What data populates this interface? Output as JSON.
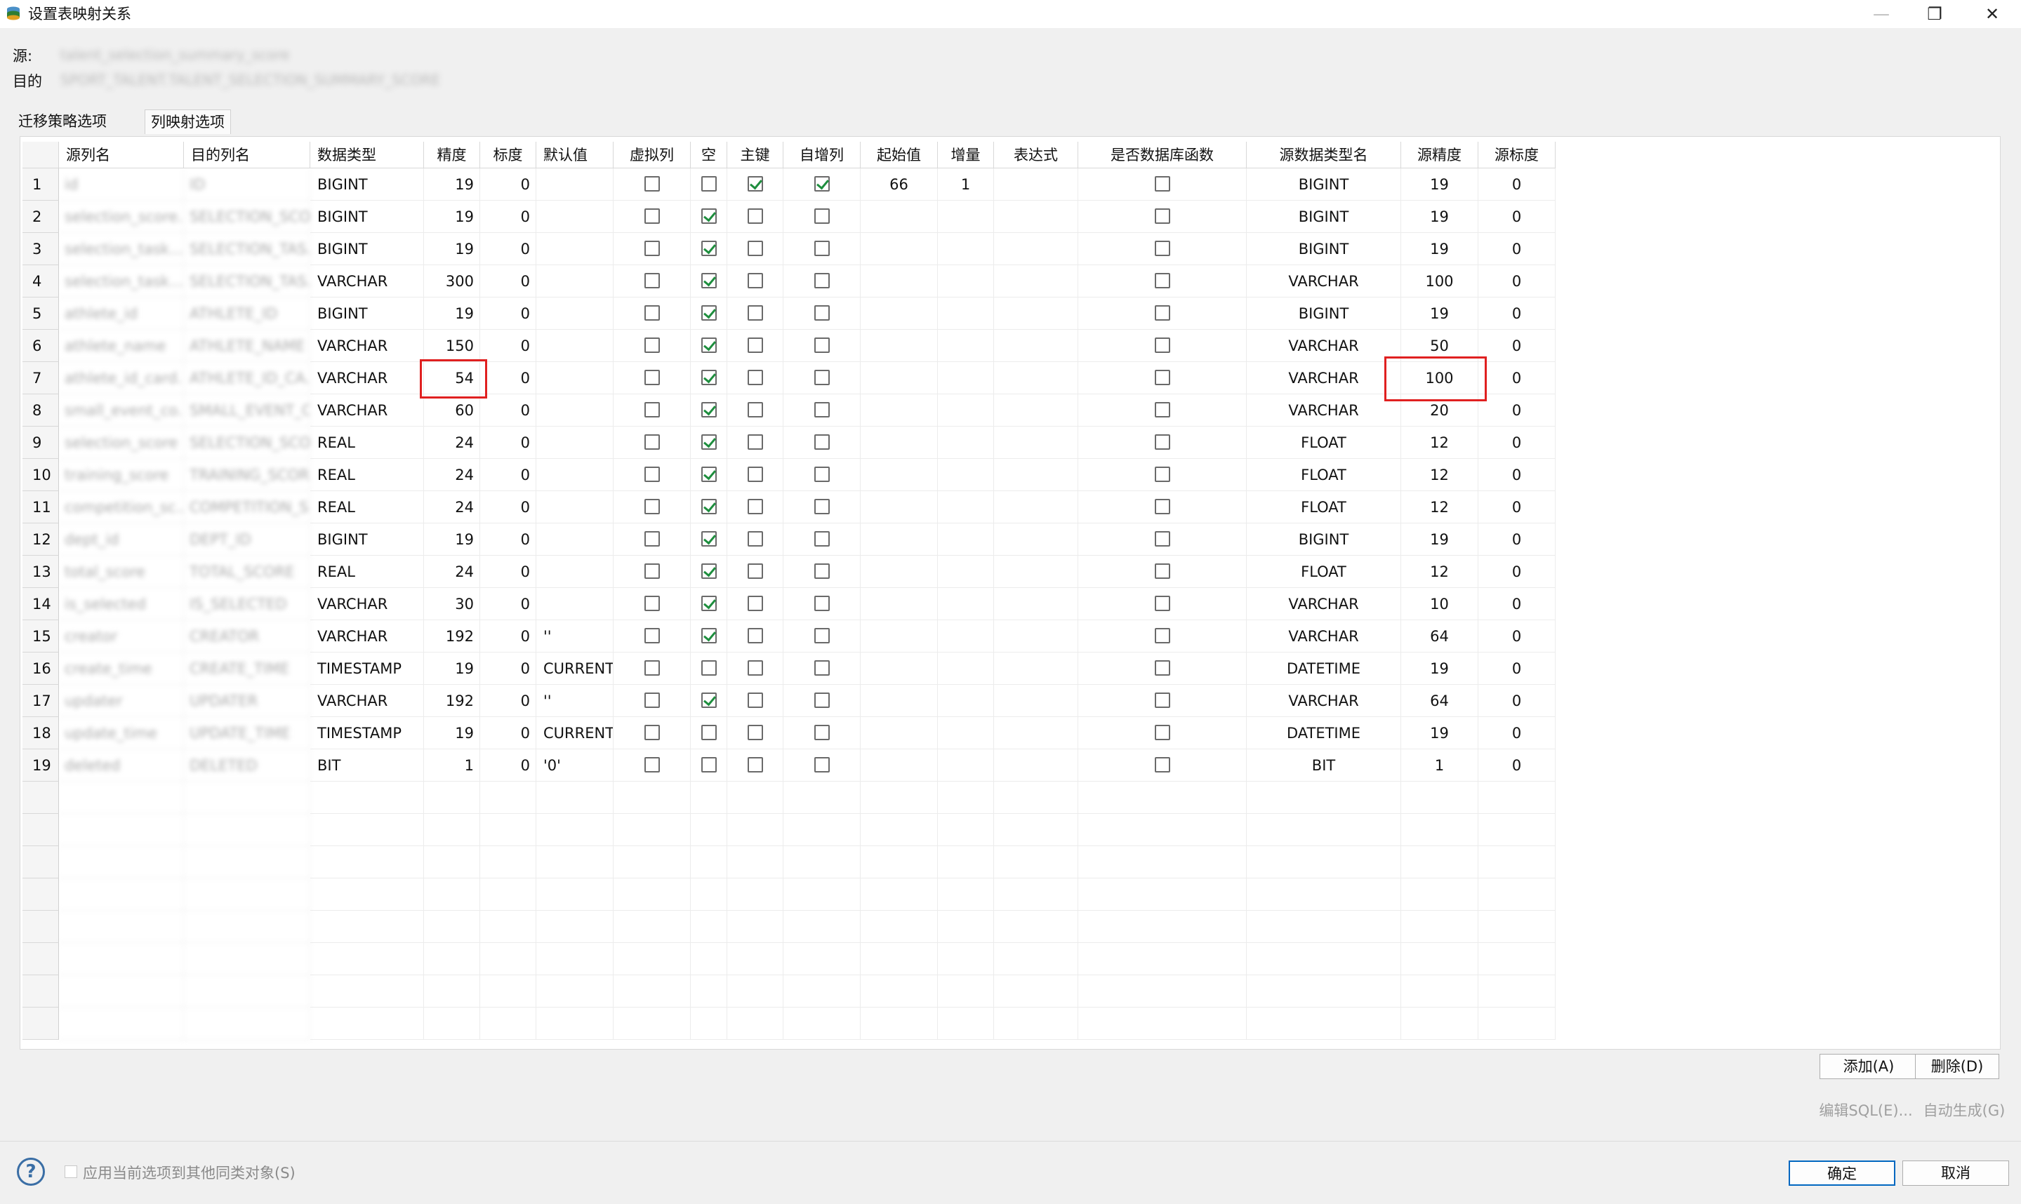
{
  "window": {
    "title": "设置表映射关系",
    "controls": {
      "minimize": "—",
      "restore": "❐",
      "close": "✕"
    }
  },
  "header": {
    "source_label": "源:",
    "source_value": "talent_selection_summary_score",
    "target_label": "目的",
    "target_value": "SPORT_TALENT.TALENT_SELECTION_SUMMARY_SCORE"
  },
  "tabs": [
    {
      "label": "迁移策略选项",
      "active": false
    },
    {
      "label": "列映射选项",
      "active": true
    }
  ],
  "columns": [
    "源列名",
    "目的列名",
    "数据类型",
    "精度",
    "标度",
    "默认值",
    "虚拟列",
    "空",
    "主键",
    "自增列",
    "起始值",
    "增量",
    "表达式",
    "是否数据库函数",
    "源数据类型名",
    "源精度",
    "源标度"
  ],
  "rows": [
    {
      "n": "1",
      "src": "id",
      "dst": "ID",
      "type": "BIGINT",
      "prec": "19",
      "scale": "0",
      "def": "",
      "virt": false,
      "nul": false,
      "pk": true,
      "ai": true,
      "start": "66",
      "inc": "1",
      "expr": "",
      "dbfn": false,
      "stype": "BIGINT",
      "sprec": "19",
      "sscale": "0"
    },
    {
      "n": "2",
      "src": "selection_score...",
      "dst": "SELECTION_SCO...",
      "type": "BIGINT",
      "prec": "19",
      "scale": "0",
      "def": "",
      "virt": false,
      "nul": true,
      "pk": false,
      "ai": false,
      "start": "",
      "inc": "",
      "expr": "",
      "dbfn": false,
      "stype": "BIGINT",
      "sprec": "19",
      "sscale": "0"
    },
    {
      "n": "3",
      "src": "selection_task...",
      "dst": "SELECTION_TAS...",
      "type": "BIGINT",
      "prec": "19",
      "scale": "0",
      "def": "",
      "virt": false,
      "nul": true,
      "pk": false,
      "ai": false,
      "start": "",
      "inc": "",
      "expr": "",
      "dbfn": false,
      "stype": "BIGINT",
      "sprec": "19",
      "sscale": "0"
    },
    {
      "n": "4",
      "src": "selection_task...",
      "dst": "SELECTION_TAS...",
      "type": "VARCHAR",
      "prec": "300",
      "scale": "0",
      "def": "",
      "virt": false,
      "nul": true,
      "pk": false,
      "ai": false,
      "start": "",
      "inc": "",
      "expr": "",
      "dbfn": false,
      "stype": "VARCHAR",
      "sprec": "100",
      "sscale": "0"
    },
    {
      "n": "5",
      "src": "athlete_id",
      "dst": "ATHLETE_ID",
      "type": "BIGINT",
      "prec": "19",
      "scale": "0",
      "def": "",
      "virt": false,
      "nul": true,
      "pk": false,
      "ai": false,
      "start": "",
      "inc": "",
      "expr": "",
      "dbfn": false,
      "stype": "BIGINT",
      "sprec": "19",
      "sscale": "0"
    },
    {
      "n": "6",
      "src": "athlete_name",
      "dst": "ATHLETE_NAME",
      "type": "VARCHAR",
      "prec": "150",
      "scale": "0",
      "def": "",
      "virt": false,
      "nul": true,
      "pk": false,
      "ai": false,
      "start": "",
      "inc": "",
      "expr": "",
      "dbfn": false,
      "stype": "VARCHAR",
      "sprec": "50",
      "sscale": "0"
    },
    {
      "n": "7",
      "src": "athlete_id_card...",
      "dst": "ATHLETE_ID_CA...",
      "type": "VARCHAR",
      "prec": "54",
      "scale": "0",
      "def": "",
      "virt": false,
      "nul": true,
      "pk": false,
      "ai": false,
      "start": "",
      "inc": "",
      "expr": "",
      "dbfn": false,
      "stype": "VARCHAR",
      "sprec": "100",
      "sscale": "0"
    },
    {
      "n": "8",
      "src": "small_event_co...",
      "dst": "SMALL_EVENT_C...",
      "type": "VARCHAR",
      "prec": "60",
      "scale": "0",
      "def": "",
      "virt": false,
      "nul": true,
      "pk": false,
      "ai": false,
      "start": "",
      "inc": "",
      "expr": "",
      "dbfn": false,
      "stype": "VARCHAR",
      "sprec": "20",
      "sscale": "0"
    },
    {
      "n": "9",
      "src": "selection_score",
      "dst": "SELECTION_SCO...",
      "type": "REAL",
      "prec": "24",
      "scale": "0",
      "def": "",
      "virt": false,
      "nul": true,
      "pk": false,
      "ai": false,
      "start": "",
      "inc": "",
      "expr": "",
      "dbfn": false,
      "stype": "FLOAT",
      "sprec": "12",
      "sscale": "0"
    },
    {
      "n": "10",
      "src": "training_score",
      "dst": "TRAINING_SCOR...",
      "type": "REAL",
      "prec": "24",
      "scale": "0",
      "def": "",
      "virt": false,
      "nul": true,
      "pk": false,
      "ai": false,
      "start": "",
      "inc": "",
      "expr": "",
      "dbfn": false,
      "stype": "FLOAT",
      "sprec": "12",
      "sscale": "0"
    },
    {
      "n": "11",
      "src": "competition_sc...",
      "dst": "COMPETITION_S...",
      "type": "REAL",
      "prec": "24",
      "scale": "0",
      "def": "",
      "virt": false,
      "nul": true,
      "pk": false,
      "ai": false,
      "start": "",
      "inc": "",
      "expr": "",
      "dbfn": false,
      "stype": "FLOAT",
      "sprec": "12",
      "sscale": "0"
    },
    {
      "n": "12",
      "src": "dept_id",
      "dst": "DEPT_ID",
      "type": "BIGINT",
      "prec": "19",
      "scale": "0",
      "def": "",
      "virt": false,
      "nul": true,
      "pk": false,
      "ai": false,
      "start": "",
      "inc": "",
      "expr": "",
      "dbfn": false,
      "stype": "BIGINT",
      "sprec": "19",
      "sscale": "0"
    },
    {
      "n": "13",
      "src": "total_score",
      "dst": "TOTAL_SCORE",
      "type": "REAL",
      "prec": "24",
      "scale": "0",
      "def": "",
      "virt": false,
      "nul": true,
      "pk": false,
      "ai": false,
      "start": "",
      "inc": "",
      "expr": "",
      "dbfn": false,
      "stype": "FLOAT",
      "sprec": "12",
      "sscale": "0"
    },
    {
      "n": "14",
      "src": "is_selected",
      "dst": "IS_SELECTED",
      "type": "VARCHAR",
      "prec": "30",
      "scale": "0",
      "def": "",
      "virt": false,
      "nul": true,
      "pk": false,
      "ai": false,
      "start": "",
      "inc": "",
      "expr": "",
      "dbfn": false,
      "stype": "VARCHAR",
      "sprec": "10",
      "sscale": "0"
    },
    {
      "n": "15",
      "src": "creator",
      "dst": "CREATOR",
      "type": "VARCHAR",
      "prec": "192",
      "scale": "0",
      "def": "''",
      "virt": false,
      "nul": true,
      "pk": false,
      "ai": false,
      "start": "",
      "inc": "",
      "expr": "",
      "dbfn": false,
      "stype": "VARCHAR",
      "sprec": "64",
      "sscale": "0"
    },
    {
      "n": "16",
      "src": "create_time",
      "dst": "CREATE_TIME",
      "type": "TIMESTAMP",
      "prec": "19",
      "scale": "0",
      "def": "CURRENT.",
      "virt": false,
      "nul": false,
      "pk": false,
      "ai": false,
      "start": "",
      "inc": "",
      "expr": "",
      "dbfn": false,
      "stype": "DATETIME",
      "sprec": "19",
      "sscale": "0"
    },
    {
      "n": "17",
      "src": "updater",
      "dst": "UPDATER",
      "type": "VARCHAR",
      "prec": "192",
      "scale": "0",
      "def": "''",
      "virt": false,
      "nul": true,
      "pk": false,
      "ai": false,
      "start": "",
      "inc": "",
      "expr": "",
      "dbfn": false,
      "stype": "VARCHAR",
      "sprec": "64",
      "sscale": "0"
    },
    {
      "n": "18",
      "src": "update_time",
      "dst": "UPDATE_TIME",
      "type": "TIMESTAMP",
      "prec": "19",
      "scale": "0",
      "def": "CURRENT.",
      "virt": false,
      "nul": false,
      "pk": false,
      "ai": false,
      "start": "",
      "inc": "",
      "expr": "",
      "dbfn": false,
      "stype": "DATETIME",
      "sprec": "19",
      "sscale": "0"
    },
    {
      "n": "19",
      "src": "deleted",
      "dst": "DELETED",
      "type": "BIT",
      "prec": "1",
      "scale": "0",
      "def": "'0'",
      "virt": false,
      "nul": false,
      "pk": false,
      "ai": false,
      "start": "",
      "inc": "",
      "expr": "",
      "dbfn": false,
      "stype": "BIT",
      "sprec": "1",
      "sscale": "0"
    }
  ],
  "empty_row_count": 8,
  "buttons": {
    "add": "添加(A)",
    "delete": "删除(D)",
    "edit_sql": "编辑SQL(E)...",
    "auto_generate": "自动生成(G)",
    "ok": "确定",
    "cancel": "取消"
  },
  "footer": {
    "apply_label": "应用当前选项到其他同类对象(S)",
    "help_icon": "?"
  },
  "colors": {
    "highlight": "#e02020",
    "check": "#1e8e3e",
    "primary_border": "#0067c0"
  }
}
